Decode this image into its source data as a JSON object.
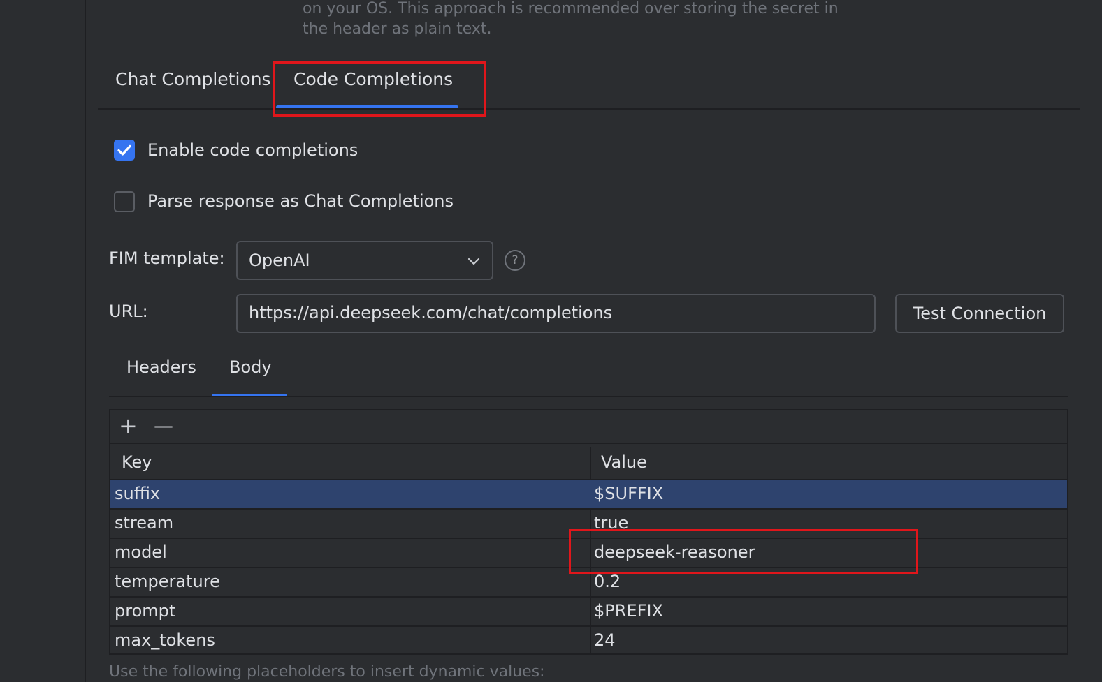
{
  "intro": {
    "line1": "on your OS. This approach is recommended over storing the secret in",
    "line2": "the header as plain text."
  },
  "main_tabs": [
    {
      "label": "Chat Completions",
      "selected": false
    },
    {
      "label": "Code Completions",
      "selected": true
    }
  ],
  "options": {
    "enable_code_completions": {
      "label": "Enable code completions",
      "checked": true
    },
    "parse_response": {
      "label": "Parse response as Chat Completions",
      "checked": false
    }
  },
  "fim": {
    "label": "FIM template:",
    "value": "OpenAI"
  },
  "url": {
    "label": "URL:",
    "value": "https://api.deepseek.com/chat/completions"
  },
  "test_connection": "Test Connection",
  "sub_tabs": [
    {
      "label": "Headers",
      "selected": false
    },
    {
      "label": "Body",
      "selected": true
    }
  ],
  "table": {
    "toolbar": {
      "add": "+",
      "remove": "—"
    },
    "columns": [
      "Key",
      "Value"
    ],
    "rows": [
      {
        "key": "suffix",
        "value": "$SUFFIX",
        "selected": true
      },
      {
        "key": "stream",
        "value": "true",
        "selected": false
      },
      {
        "key": "model",
        "value": "deepseek-reasoner",
        "selected": false
      },
      {
        "key": "temperature",
        "value": "0.2",
        "selected": false
      },
      {
        "key": "prompt",
        "value": "$PREFIX",
        "selected": false
      },
      {
        "key": "max_tokens",
        "value": "24",
        "selected": false
      }
    ]
  },
  "footer_hint": "Use the following placeholders to insert dynamic values:",
  "colors": {
    "accent": "#3574f0",
    "highlight": "#e0161b",
    "selection": "#2e436e"
  }
}
